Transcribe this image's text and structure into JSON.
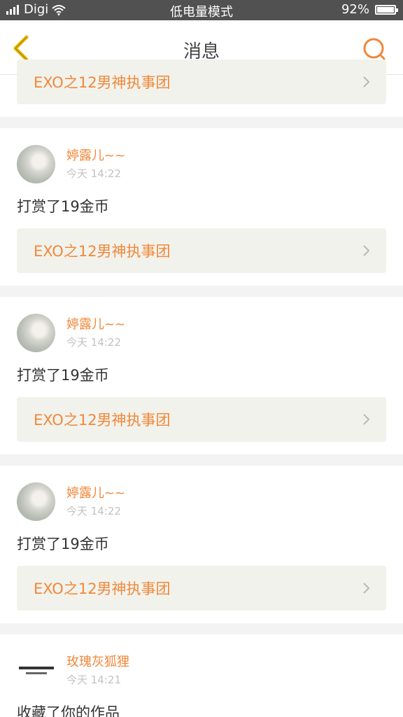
{
  "status_bar": {
    "carrier": "Digi",
    "mode": "低电量模式",
    "battery_percent": "92%",
    "battery_level": 0.92
  },
  "header": {
    "title": "消息",
    "back_icon": "chevron-left-icon",
    "search_icon": "search-icon",
    "accent_color": "#f0883a"
  },
  "top_link": {
    "label": "EXO之12男神执事团"
  },
  "messages": [
    {
      "username": "婷露儿~~",
      "time": "今天 14:22",
      "action": "打赏了19金币",
      "link": "EXO之12男神执事团"
    },
    {
      "username": "婷露儿~~",
      "time": "今天 14:22",
      "action": "打赏了19金币",
      "link": "EXO之12男神执事团"
    },
    {
      "username": "婷露儿~~",
      "time": "今天 14:22",
      "action": "打赏了19金币",
      "link": "EXO之12男神执事团"
    },
    {
      "username": "玫瑰灰狐狸",
      "time": "今天 14:21",
      "action": "收藏了你的作品"
    }
  ]
}
